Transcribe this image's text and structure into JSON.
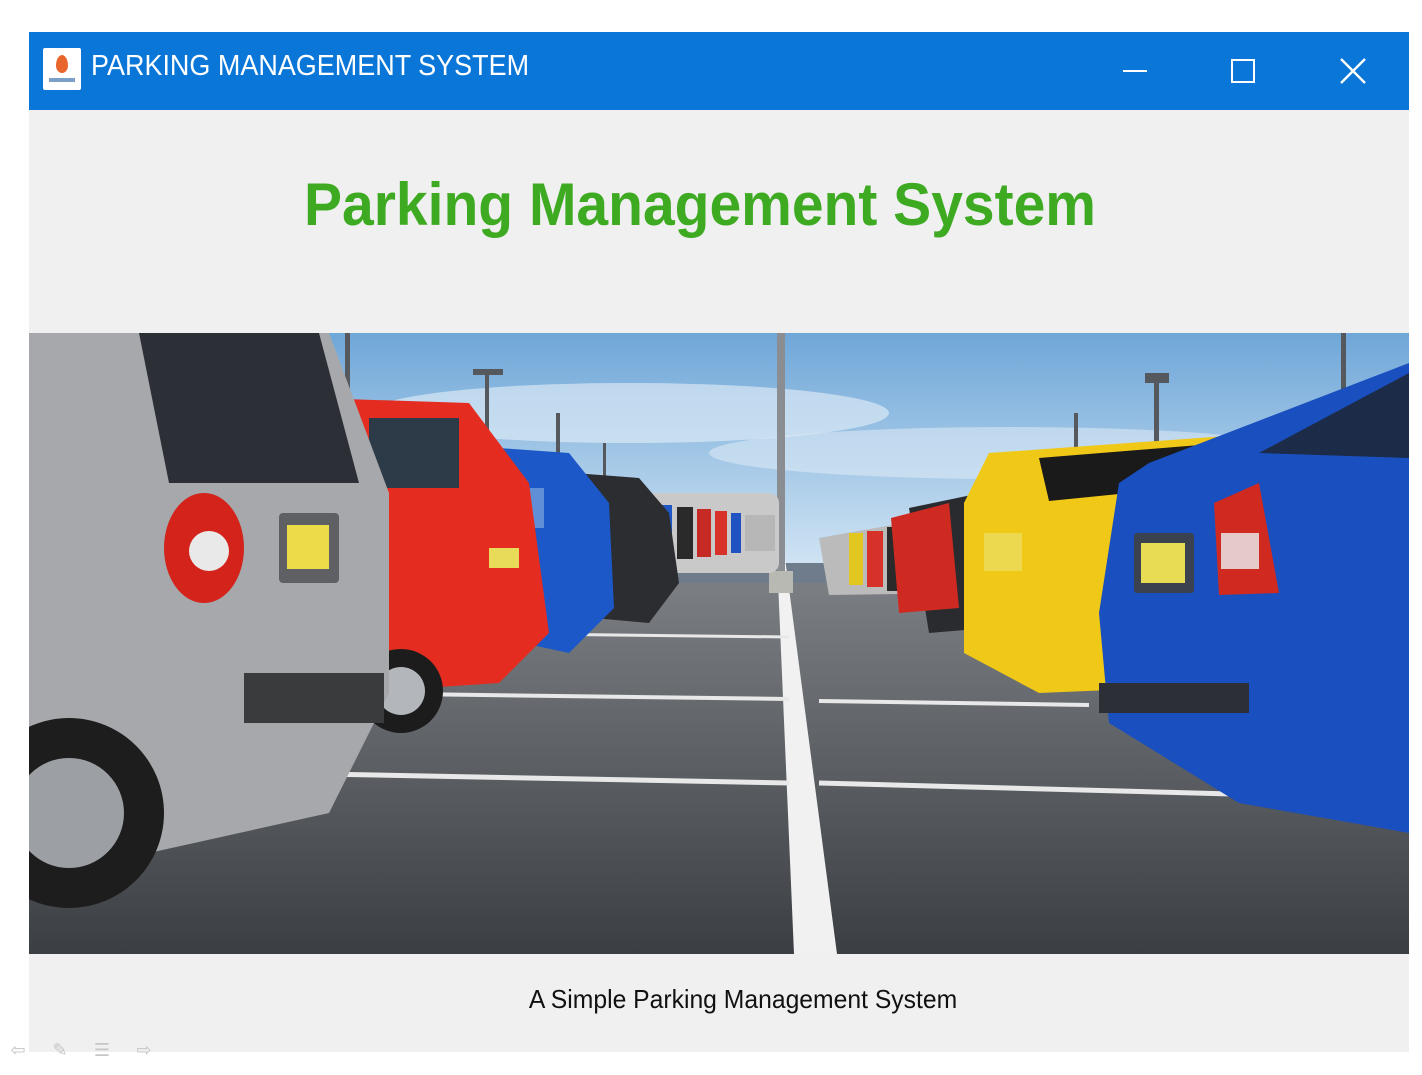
{
  "window": {
    "title": "PARKING MANAGEMENT SYSTEM",
    "app_icon": "app-logo-icon",
    "controls": {
      "minimize_icon": "minimize-icon",
      "maximize_icon": "maximize-icon",
      "close_icon": "close-icon"
    }
  },
  "main": {
    "heading": "Parking Management System",
    "heading_color": "#3daa22",
    "image": "parking-lot-cars-photo",
    "subtitle": "A Simple Parking Management System"
  },
  "titlebar_color": "#0a76d8",
  "nav_icons": [
    "back-arrow-icon",
    "pen-icon",
    "menu-icon",
    "forward-arrow-icon"
  ]
}
